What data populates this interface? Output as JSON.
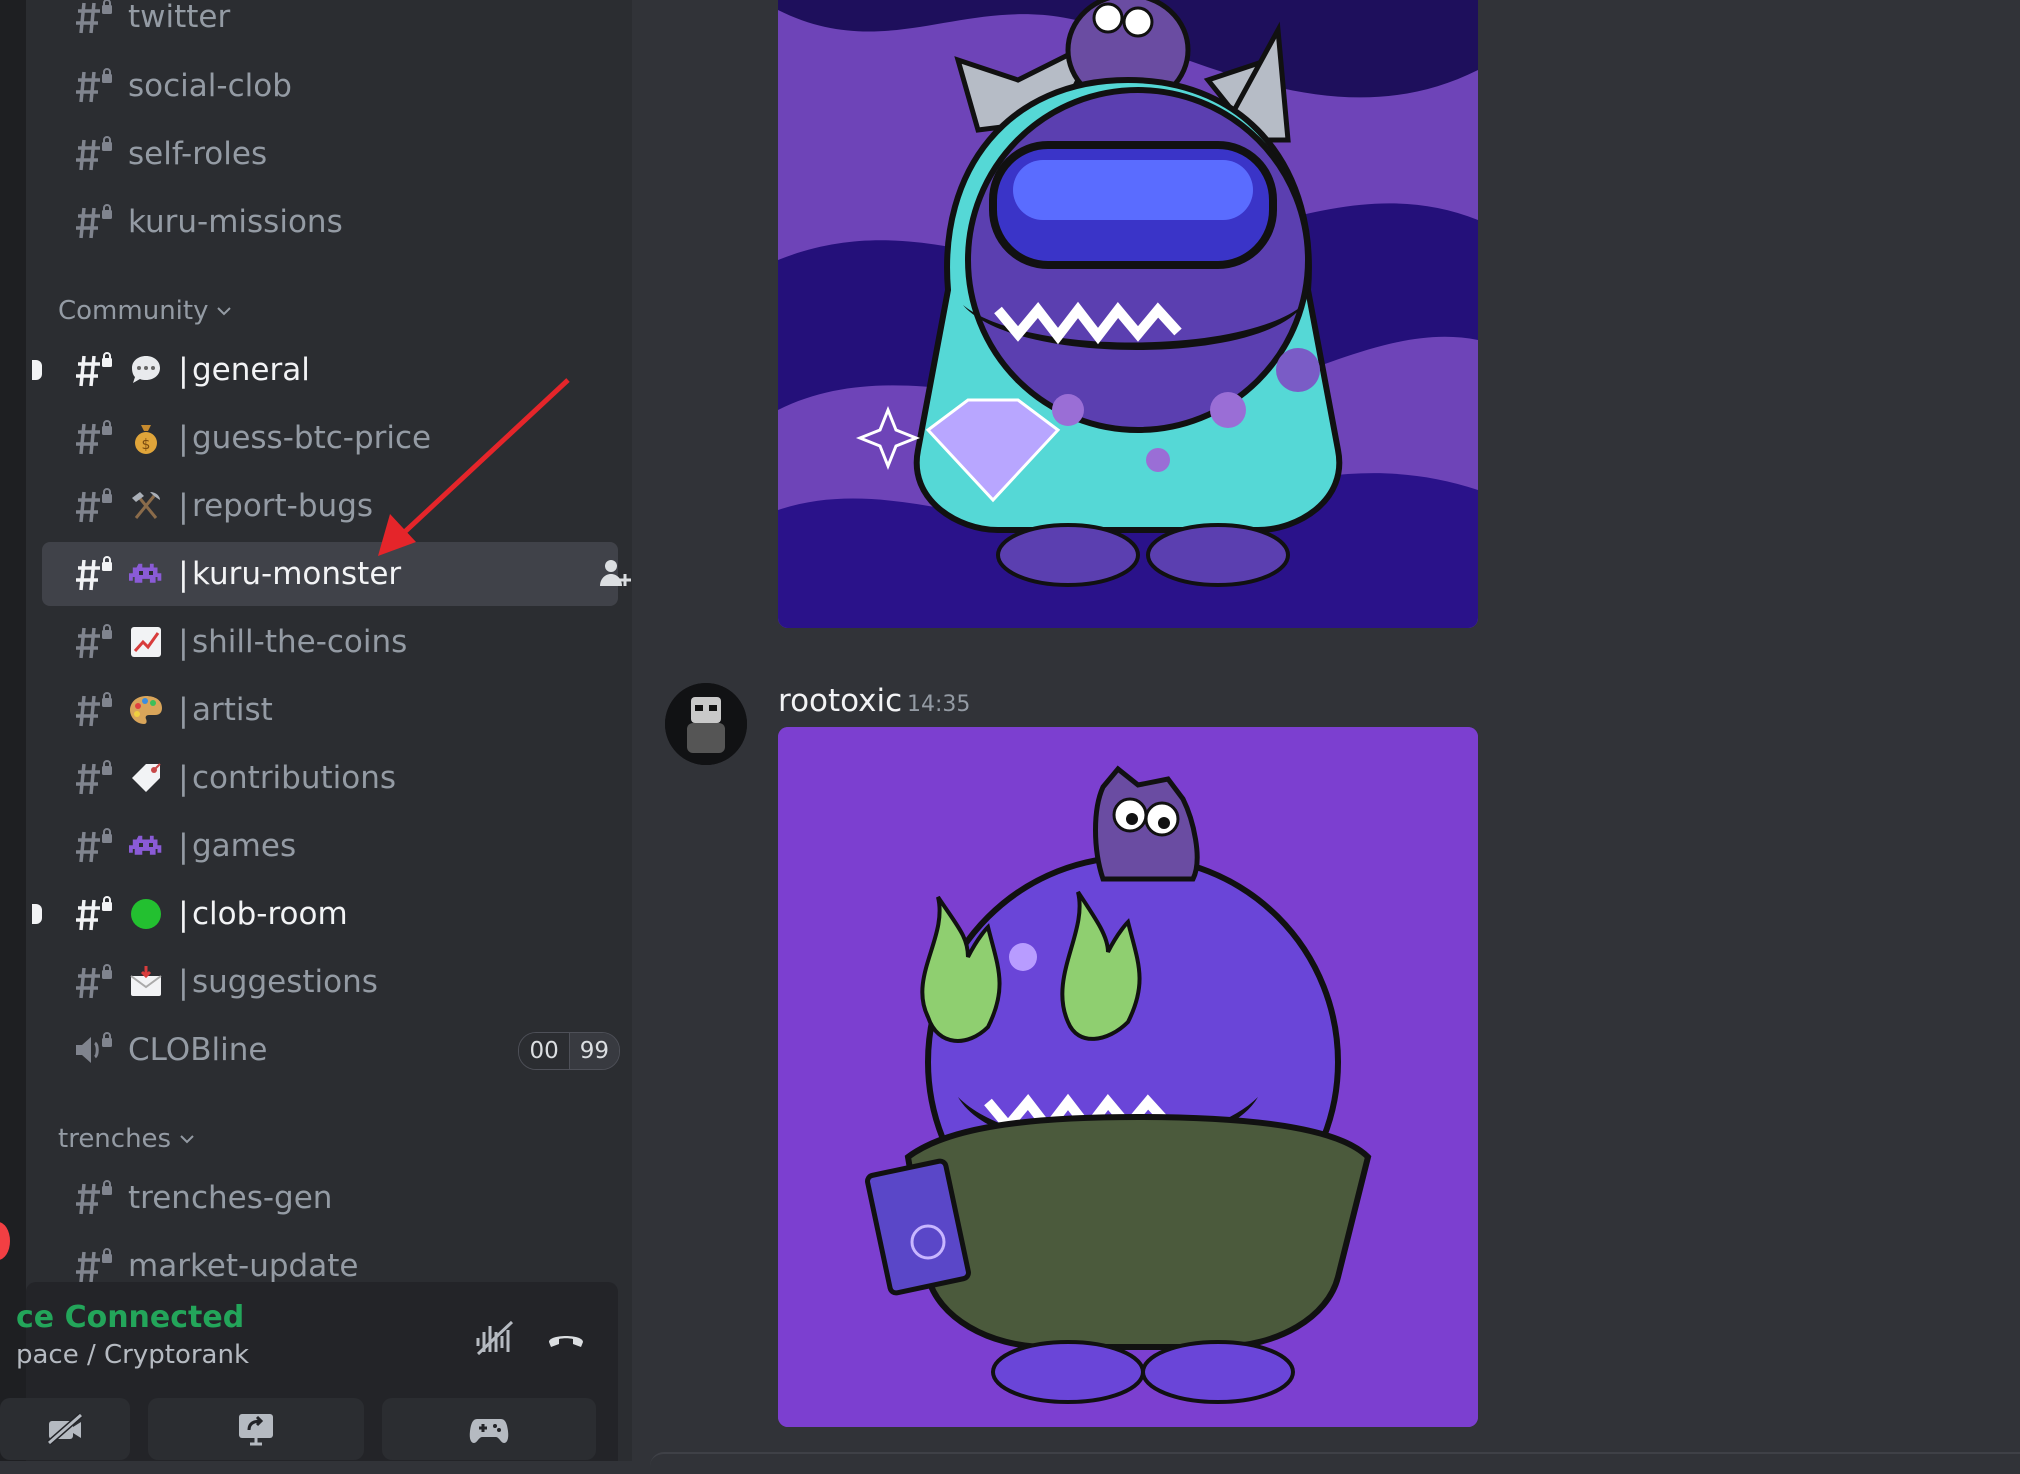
{
  "sidebar": {
    "channels_top": [
      {
        "name": "twitter"
      },
      {
        "name": "social-clob"
      },
      {
        "name": "self-roles"
      },
      {
        "name": "kuru-missions"
      }
    ],
    "category_community": "Community",
    "community_channels": [
      {
        "label": "general",
        "emoji": "speech-bubble",
        "unread": true
      },
      {
        "label": "guess-btc-price",
        "emoji": "money-bag",
        "unread": false
      },
      {
        "label": "report-bugs",
        "emoji": "hammer-and-pick",
        "unread": false
      },
      {
        "label": "kuru-monster",
        "emoji": "space-invader",
        "unread": false,
        "active": true
      },
      {
        "label": "shill-the-coins",
        "emoji": "chart-increasing",
        "unread": false
      },
      {
        "label": "artist",
        "emoji": "artist-palette",
        "unread": false
      },
      {
        "label": "contributions",
        "emoji": "label-tag",
        "unread": false
      },
      {
        "label": "games",
        "emoji": "space-invader",
        "unread": false
      },
      {
        "label": "clob-room",
        "emoji": "green-circle",
        "unread": true
      },
      {
        "label": "suggestions",
        "emoji": "envelope-with-arrow",
        "unread": false
      }
    ],
    "separator": "|",
    "voice_channel": {
      "name": "CLOBline",
      "count_left": "00",
      "count_right": "99"
    },
    "category_trenches": "trenches",
    "trenches_channels": [
      {
        "name": "trenches-gen"
      },
      {
        "name": "market-update"
      }
    ]
  },
  "voice_panel": {
    "status": "ce Connected",
    "server": "pace / Cryptorank"
  },
  "message": {
    "author": "rootoxic",
    "time": "14:35"
  },
  "colors": {
    "accent_green": "#23a55a",
    "annotation_arrow": "#e5252a",
    "image_top_bg": "#6e44b8",
    "image_bottom_bg": "#7c3fd0"
  }
}
